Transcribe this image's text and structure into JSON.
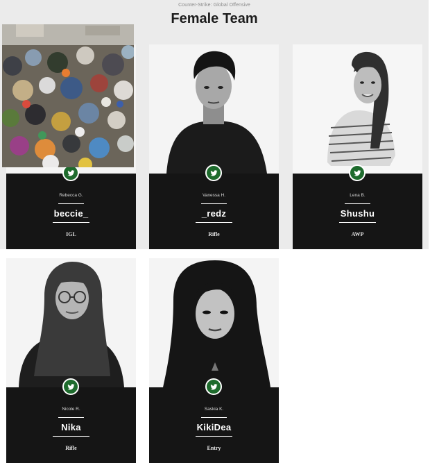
{
  "header": {
    "subtitle": "Counter-Strike: Global Offensive",
    "title": "Female Team"
  },
  "colors": {
    "accent": "#1e6b2d",
    "panel": "#151515",
    "band": "#ebebeb"
  },
  "players": [
    {
      "real_name": "Rebecca G.",
      "nickname": "beccie_",
      "role": "IGL",
      "icon": "twitter-icon",
      "photo": "trash-pile-photo"
    },
    {
      "real_name": "Vanessa H.",
      "nickname": "_redz",
      "role": "Rifle",
      "icon": "twitter-icon",
      "photo": "player-portrait"
    },
    {
      "real_name": "Lena B.",
      "nickname": "Shushu",
      "role": "AWP",
      "icon": "twitter-icon",
      "photo": "player-portrait"
    },
    {
      "real_name": "Nicole R.",
      "nickname": "Nika",
      "role": "Rifle",
      "icon": "twitter-icon",
      "photo": "player-portrait"
    },
    {
      "real_name": "Saskia K.",
      "nickname": "KikiDea",
      "role": "Entry",
      "icon": "twitter-icon",
      "photo": "player-portrait"
    }
  ]
}
